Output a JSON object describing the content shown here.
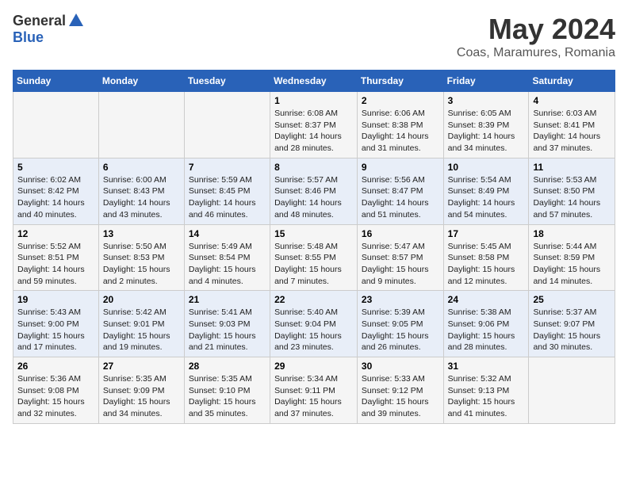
{
  "logo": {
    "line1": "General",
    "line2": "Blue"
  },
  "title": "May 2024",
  "subtitle": "Coas, Maramures, Romania",
  "days_of_week": [
    "Sunday",
    "Monday",
    "Tuesday",
    "Wednesday",
    "Thursday",
    "Friday",
    "Saturday"
  ],
  "weeks": [
    [
      {
        "day": "",
        "info": ""
      },
      {
        "day": "",
        "info": ""
      },
      {
        "day": "",
        "info": ""
      },
      {
        "day": "1",
        "info": "Sunrise: 6:08 AM\nSunset: 8:37 PM\nDaylight: 14 hours and 28 minutes."
      },
      {
        "day": "2",
        "info": "Sunrise: 6:06 AM\nSunset: 8:38 PM\nDaylight: 14 hours and 31 minutes."
      },
      {
        "day": "3",
        "info": "Sunrise: 6:05 AM\nSunset: 8:39 PM\nDaylight: 14 hours and 34 minutes."
      },
      {
        "day": "4",
        "info": "Sunrise: 6:03 AM\nSunset: 8:41 PM\nDaylight: 14 hours and 37 minutes."
      }
    ],
    [
      {
        "day": "5",
        "info": "Sunrise: 6:02 AM\nSunset: 8:42 PM\nDaylight: 14 hours and 40 minutes."
      },
      {
        "day": "6",
        "info": "Sunrise: 6:00 AM\nSunset: 8:43 PM\nDaylight: 14 hours and 43 minutes."
      },
      {
        "day": "7",
        "info": "Sunrise: 5:59 AM\nSunset: 8:45 PM\nDaylight: 14 hours and 46 minutes."
      },
      {
        "day": "8",
        "info": "Sunrise: 5:57 AM\nSunset: 8:46 PM\nDaylight: 14 hours and 48 minutes."
      },
      {
        "day": "9",
        "info": "Sunrise: 5:56 AM\nSunset: 8:47 PM\nDaylight: 14 hours and 51 minutes."
      },
      {
        "day": "10",
        "info": "Sunrise: 5:54 AM\nSunset: 8:49 PM\nDaylight: 14 hours and 54 minutes."
      },
      {
        "day": "11",
        "info": "Sunrise: 5:53 AM\nSunset: 8:50 PM\nDaylight: 14 hours and 57 minutes."
      }
    ],
    [
      {
        "day": "12",
        "info": "Sunrise: 5:52 AM\nSunset: 8:51 PM\nDaylight: 14 hours and 59 minutes."
      },
      {
        "day": "13",
        "info": "Sunrise: 5:50 AM\nSunset: 8:53 PM\nDaylight: 15 hours and 2 minutes."
      },
      {
        "day": "14",
        "info": "Sunrise: 5:49 AM\nSunset: 8:54 PM\nDaylight: 15 hours and 4 minutes."
      },
      {
        "day": "15",
        "info": "Sunrise: 5:48 AM\nSunset: 8:55 PM\nDaylight: 15 hours and 7 minutes."
      },
      {
        "day": "16",
        "info": "Sunrise: 5:47 AM\nSunset: 8:57 PM\nDaylight: 15 hours and 9 minutes."
      },
      {
        "day": "17",
        "info": "Sunrise: 5:45 AM\nSunset: 8:58 PM\nDaylight: 15 hours and 12 minutes."
      },
      {
        "day": "18",
        "info": "Sunrise: 5:44 AM\nSunset: 8:59 PM\nDaylight: 15 hours and 14 minutes."
      }
    ],
    [
      {
        "day": "19",
        "info": "Sunrise: 5:43 AM\nSunset: 9:00 PM\nDaylight: 15 hours and 17 minutes."
      },
      {
        "day": "20",
        "info": "Sunrise: 5:42 AM\nSunset: 9:01 PM\nDaylight: 15 hours and 19 minutes."
      },
      {
        "day": "21",
        "info": "Sunrise: 5:41 AM\nSunset: 9:03 PM\nDaylight: 15 hours and 21 minutes."
      },
      {
        "day": "22",
        "info": "Sunrise: 5:40 AM\nSunset: 9:04 PM\nDaylight: 15 hours and 23 minutes."
      },
      {
        "day": "23",
        "info": "Sunrise: 5:39 AM\nSunset: 9:05 PM\nDaylight: 15 hours and 26 minutes."
      },
      {
        "day": "24",
        "info": "Sunrise: 5:38 AM\nSunset: 9:06 PM\nDaylight: 15 hours and 28 minutes."
      },
      {
        "day": "25",
        "info": "Sunrise: 5:37 AM\nSunset: 9:07 PM\nDaylight: 15 hours and 30 minutes."
      }
    ],
    [
      {
        "day": "26",
        "info": "Sunrise: 5:36 AM\nSunset: 9:08 PM\nDaylight: 15 hours and 32 minutes."
      },
      {
        "day": "27",
        "info": "Sunrise: 5:35 AM\nSunset: 9:09 PM\nDaylight: 15 hours and 34 minutes."
      },
      {
        "day": "28",
        "info": "Sunrise: 5:35 AM\nSunset: 9:10 PM\nDaylight: 15 hours and 35 minutes."
      },
      {
        "day": "29",
        "info": "Sunrise: 5:34 AM\nSunset: 9:11 PM\nDaylight: 15 hours and 37 minutes."
      },
      {
        "day": "30",
        "info": "Sunrise: 5:33 AM\nSunset: 9:12 PM\nDaylight: 15 hours and 39 minutes."
      },
      {
        "day": "31",
        "info": "Sunrise: 5:32 AM\nSunset: 9:13 PM\nDaylight: 15 hours and 41 minutes."
      },
      {
        "day": "",
        "info": ""
      }
    ]
  ]
}
